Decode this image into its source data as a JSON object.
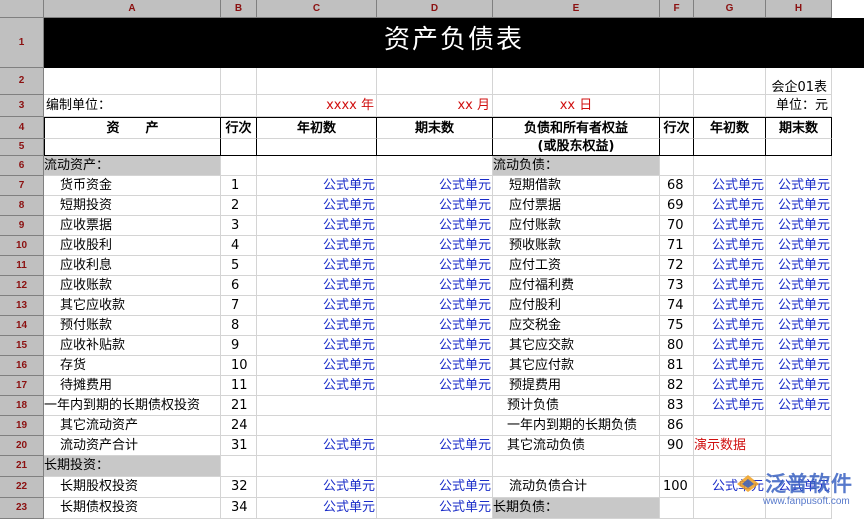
{
  "columns": [
    "A",
    "B",
    "C",
    "D",
    "E",
    "F",
    "G",
    "H"
  ],
  "rows": [
    "1",
    "2",
    "3",
    "4",
    "5",
    "6",
    "7",
    "8",
    "9",
    "10",
    "11",
    "12",
    "13",
    "14",
    "15",
    "16",
    "17",
    "18",
    "19",
    "20",
    "21",
    "22",
    "23"
  ],
  "title": "资产负债表",
  "form_code": "会企01表",
  "unit_label": "编制单位：",
  "year_label": "xxxx 年",
  "month_label": "xx 月",
  "day_label": "xx 日",
  "currency_unit": "单位：元",
  "headers": {
    "asset": "资　　产",
    "line": "行次",
    "begin": "年初数",
    "end": "期末数",
    "liab_line1": "负债和所有者权益",
    "liab_line2": "(或股东权益)",
    "line2": "行次",
    "begin2": "年初数",
    "end2": "期末数"
  },
  "section_current_assets": "流动资产：",
  "section_current_liab": "流动负债：",
  "section_long_invest": "长期投资：",
  "section_long_liab": "长期负债：",
  "formula_text": "公式单元",
  "demo_text": "演示数据",
  "asset_rows": [
    {
      "name": "货币资金",
      "line": "1"
    },
    {
      "name": "短期投资",
      "line": "2"
    },
    {
      "name": "应收票据",
      "line": "3"
    },
    {
      "name": "应收股利",
      "line": "4"
    },
    {
      "name": "应收利息",
      "line": "5"
    },
    {
      "name": "应收账款",
      "line": "6"
    },
    {
      "name": "其它应收款",
      "line": "7"
    },
    {
      "name": "预付账款",
      "line": "8"
    },
    {
      "name": "应收补贴款",
      "line": "9"
    },
    {
      "name": "存货",
      "line": "10"
    },
    {
      "name": "待摊费用",
      "line": "11"
    },
    {
      "name": "一年内到期的长期债权投资",
      "line": "21"
    },
    {
      "name": "其它流动资产",
      "line": "24"
    },
    {
      "name": "流动资产合计",
      "line": "31"
    }
  ],
  "liab_rows": [
    {
      "name": "短期借款",
      "line": "68"
    },
    {
      "name": "应付票据",
      "line": "69"
    },
    {
      "name": "应付账款",
      "line": "70"
    },
    {
      "name": "预收账款",
      "line": "71"
    },
    {
      "name": "应付工资",
      "line": "72"
    },
    {
      "name": "应付福利费",
      "line": "73"
    },
    {
      "name": "应付股利",
      "line": "74"
    },
    {
      "name": "应交税金",
      "line": "75"
    },
    {
      "name": "其它应交款",
      "line": "80"
    },
    {
      "name": "其它应付款",
      "line": "81"
    },
    {
      "name": "预提费用",
      "line": "82"
    },
    {
      "name": "预计负债",
      "line": "83"
    },
    {
      "name": "一年内到期的长期负债",
      "line": "86"
    },
    {
      "name": "其它流动负债",
      "line": "90"
    }
  ],
  "row22": {
    "asset_name": "长期股权投资",
    "asset_line": "32",
    "liab_name": "流动负债合计",
    "liab_line": "100"
  },
  "row23": {
    "asset_name": "长期债权投资",
    "asset_line": "34"
  },
  "watermark": {
    "text": "泛普软件",
    "url": "www.fanpusoft.com"
  },
  "colors": {
    "header_bg": "#c0c0c0",
    "section_bg": "#c8c8c8",
    "formula": "#1a2cc8",
    "demo": "#d01010",
    "title_bg": "#000000"
  }
}
